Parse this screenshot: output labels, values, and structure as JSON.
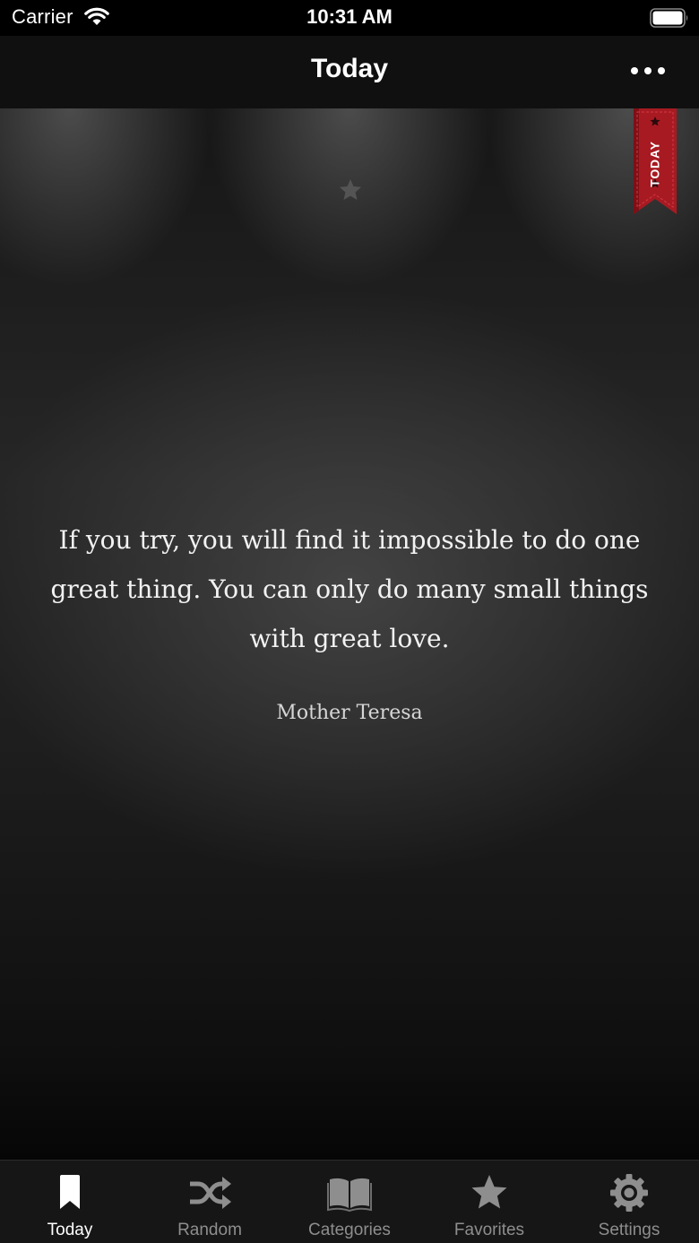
{
  "status_bar": {
    "carrier": "Carrier",
    "time": "10:31 AM",
    "icons": [
      "wifi-icon",
      "battery-icon"
    ]
  },
  "nav": {
    "title": "Today",
    "more_icon": "more-dots-icon"
  },
  "ribbon": {
    "label": "TODAY",
    "color": "#b01c24"
  },
  "quote": {
    "text": "If you try, you will find it impossible to do one great thing. You can only do many small things with great love.",
    "author": "Mother Teresa",
    "favorite_icon": "star-icon"
  },
  "tab_bar": {
    "selected": "Today",
    "tabs": [
      {
        "label": "Today",
        "icon": "bookmark-icon"
      },
      {
        "label": "Random",
        "icon": "shuffle-icon"
      },
      {
        "label": "Categories",
        "icon": "book-icon"
      },
      {
        "label": "Favorites",
        "icon": "star-icon"
      },
      {
        "label": "Settings",
        "icon": "gear-icon"
      }
    ],
    "active_color": "#ffffff",
    "inactive_color": "#8e8e8e"
  }
}
